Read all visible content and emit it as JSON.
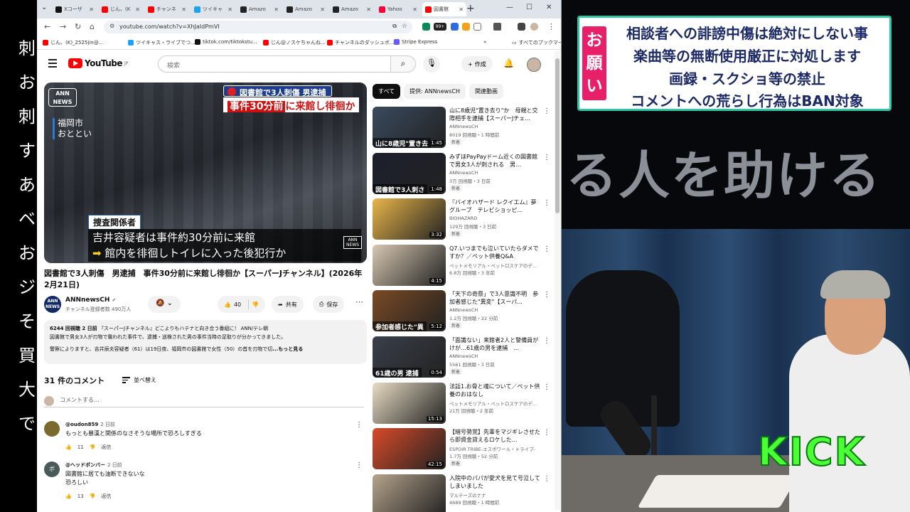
{
  "left_strip": {
    "chars": [
      "刺",
      "お",
      "刺",
      "す",
      "あ",
      "ベ",
      "お",
      "ジ",
      "そ",
      "買",
      "大",
      "で"
    ]
  },
  "browser": {
    "tabs": [
      {
        "label": "Xコーザ",
        "color": "#111111"
      },
      {
        "label": "じん、(K",
        "color": "#ff0000"
      },
      {
        "label": "チャンネ",
        "color": "#ff0000"
      },
      {
        "label": "ツイキャ",
        "color": "#1da1f2"
      },
      {
        "label": "Amazo",
        "color": "#222222"
      },
      {
        "label": "Amazo",
        "color": "#222222"
      },
      {
        "label": "Amazo",
        "color": "#222222"
      },
      {
        "label": "Yahoo",
        "color": "#ff0033"
      },
      {
        "label": "図書館",
        "color": "#ff0000",
        "active": true
      }
    ],
    "url": "youtube.com/watch?v=XhJaIdPmVI",
    "bookmarks": [
      {
        "label": "じん、(K)_2525jin@...",
        "color": "#ff0000"
      },
      {
        "label": "ツイキャス・ライブでつ...",
        "color": "#1da1f2"
      },
      {
        "label": "tiktok.com/tiktokstu...",
        "color": "#111111"
      },
      {
        "label": "じん@ノスケちゃんね...",
        "color": "#ff0000"
      },
      {
        "label": "チャンネルのダッシュボ...",
        "color": "#ff0000"
      },
      {
        "label": "Stripe Express",
        "color": "#635bff"
      }
    ],
    "all_bookmarks": "すべてのブックマーク",
    "ext_badge": "99+"
  },
  "youtube": {
    "logo_text": "YouTube",
    "logo_region": "JP",
    "search_placeholder": "検索",
    "create_label": "作成",
    "player": {
      "logo": "ANN NEWS",
      "place": [
        "福岡市",
        "おととい"
      ],
      "headline1": "図書館で3人刺傷 男逮捕",
      "headline2_red": "事件30分前",
      "headline2_rest": "に来館し徘徊か",
      "source_tag": "捜査関係者",
      "caption_line1": "吉井容疑者は事件約30分前に来館",
      "caption_line2": "館内を徘徊しトイレに入った後犯行か",
      "corner_logo": "ANN NEWS"
    },
    "video_title": "図書館で3人刺傷　男逮捕　事件30分前に来館し徘徊か【スーパーJチャンネル】(2026年2月21日)",
    "channel": {
      "name": "ANNnewsCH",
      "subs": "チャンネル登録者数 490万人",
      "avatar": "ANN NEWS"
    },
    "actions": {
      "likes": "40",
      "share": "共有",
      "save": "保存"
    },
    "description": {
      "meta": "6244 回視聴  2 日前",
      "hashtag_line": "『スーパーJチャンネル』どこよりもハテナと向き合う番組に！ ANN/テレ朝",
      "line2": "図書館で男女3人が刃物で襲われた事件で、逮捕・送検された男の事件当時の足取りが分かってきました。",
      "line3": "警察によりますと、吉井辰夫容疑者（61）は19日夜、福岡市の図書館で女性（50）の首を刃物で切",
      "more": "...もっと見る"
    },
    "comments": {
      "count_label": "31 件のコメント",
      "sort_label": "並べ替え",
      "add_placeholder": "コメントする...",
      "items": [
        {
          "user": "@oudon859",
          "time": "2 日前",
          "text": [
            "もっとも暴漢と関係のなさそうな場所で恐ろしすぎる"
          ],
          "likes": "11",
          "reply": "返信",
          "avatar_color": "#7a6a2e",
          "avatar_letter": ""
        },
        {
          "user": "@ヘッドボンバー",
          "time": "2 日前",
          "text": [
            "図書館に居ても油断できないな",
            "恐ろしい"
          ],
          "likes": "13",
          "reply": "返信",
          "avatar_color": "#4a5a5a",
          "avatar_letter": "ボ"
        }
      ]
    },
    "chips": [
      "すべて",
      "提供: ANNnewsCH",
      "関連動画"
    ],
    "recommendations": [
      {
        "title": "山に8歳児\"置き去り\"か　母親と交際相手を逮捕【スーパーJチェ...",
        "channel": "ANNnewsCH",
        "meta": "8019 回視聴・1 時間前",
        "badge": "新着",
        "duration": "1:45",
        "overlay": "山に8歳児\"置き去",
        "thumb": "#3a4a5e"
      },
      {
        "title": "みずほPayPayドーム近くの図書館で男女3人が刺される　男...",
        "channel": "ANNnewsCH",
        "meta": "3万 回視聴・3 日前",
        "badge": "新着",
        "duration": "1:48",
        "overlay": "図書館で3人刺さ",
        "thumb": "#1c1f2e"
      },
      {
        "title": "『バイオハザード レクイエム』夢グループ　テレビショッピ...",
        "channel": "BIOHAZARD",
        "meta": "129万 回視聴・3 日前",
        "badge": "新着",
        "duration": "3:32",
        "overlay": "",
        "thumb": "#e9b54a"
      },
      {
        "title": "Q7.いつまでも泣いていたらダメですか？／ペット供養Q&A",
        "channel": "ペットメモリアル・ペットロスケアのデ...",
        "meta": "6.8万 回視聴・3 年前",
        "badge": "",
        "duration": "4:15",
        "overlay": "",
        "thumb": "#d7c8b2"
      },
      {
        "title": "「天下の奇祭」で3人意識不明　参加者感じた\"異変\"【スーパ...",
        "channel": "ANNnewsCH",
        "meta": "1.2万 回視聴・22 分前",
        "badge": "新着",
        "duration": "5:12",
        "overlay": "参加者感じた\"異",
        "thumb": "#7a4a24"
      },
      {
        "title": "「面識ない」来館者2人と警備員がけが…61歳の男を逮捕　...",
        "channel": "ANNnewsCH",
        "meta": "5561 回視聴・3 日前",
        "badge": "新着",
        "duration": "0:54",
        "overlay": "61歳の男 逮捕",
        "thumb": "#3a3f4a"
      },
      {
        "title": "法話1.お骨と魂について／ペット供養のおはなし",
        "channel": "ペットメモリアル・ペットロスケアのデ...",
        "meta": "21万 回視聴・2 年前",
        "badge": "",
        "duration": "15:13",
        "overlay": "",
        "thumb": "#e8dcc4"
      },
      {
        "title": "【暗号勢覚】先輩をマジギレさせたら即資金貸えるロケした...",
        "channel": "ESPOIR TRIBE-エスポワール・トライブ-",
        "meta": "1.7万 回視聴・52 分前",
        "badge": "新着",
        "duration": "42:15",
        "overlay": "",
        "thumb": "#d84a2a"
      },
      {
        "title": "入院中のパパが愛犬を見て号泣してしまいました",
        "channel": "マルテーズのナナ",
        "meta": "4689 回視聴・1 時間前",
        "badge": "",
        "duration": "",
        "overlay": "",
        "thumb": "#b5a48c"
      }
    ]
  },
  "stream": {
    "notice_badge": "お願い",
    "notice_lines": [
      "相談者への誹謗中傷は絶対にしない事",
      "楽曲等の無断使用厳正に対処します",
      "画録・スクショ等の禁止",
      "コメントへの荒らし行為はBAN対象"
    ],
    "banner_text": "る人を助ける",
    "kick_text": "KICK"
  },
  "colors": {
    "youtube_red": "#ff0000",
    "notice_pink": "#e8206a",
    "notice_border": "#2cc7a3",
    "kick_green": "#4bff35"
  }
}
